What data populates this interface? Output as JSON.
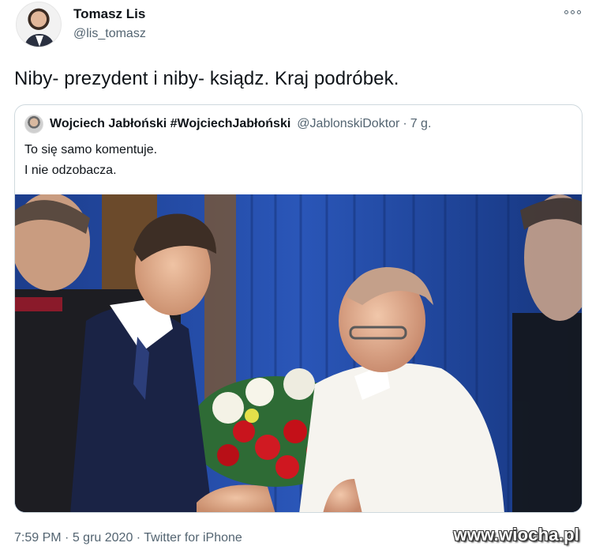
{
  "tweet": {
    "author_name": "Tomasz Lis",
    "author_handle": "@lis_tomasz",
    "text": "Niby- prezydent i niby- ksiądz. Kraj podróbek.",
    "more_icon": "more-options-icon"
  },
  "quote": {
    "author_name": "Wojciech Jabłoński #WojciechJabłoński",
    "author_handle": "@JablonskiDoktor",
    "separator": "·",
    "time": "7 g.",
    "text_line1": "To się samo komentuje.",
    "text_line2": "I nie odzobacza."
  },
  "meta": {
    "time": "7:59 PM",
    "sep1": "·",
    "date": "5 gru 2020",
    "sep2": "·",
    "source": "Twitter for iPhone"
  },
  "watermark": "www.wiocha.pl",
  "colors": {
    "text_primary": "#0f1419",
    "text_secondary": "#536471",
    "border": "#cfd9de",
    "curtain_blue": "#1e3f8f"
  }
}
